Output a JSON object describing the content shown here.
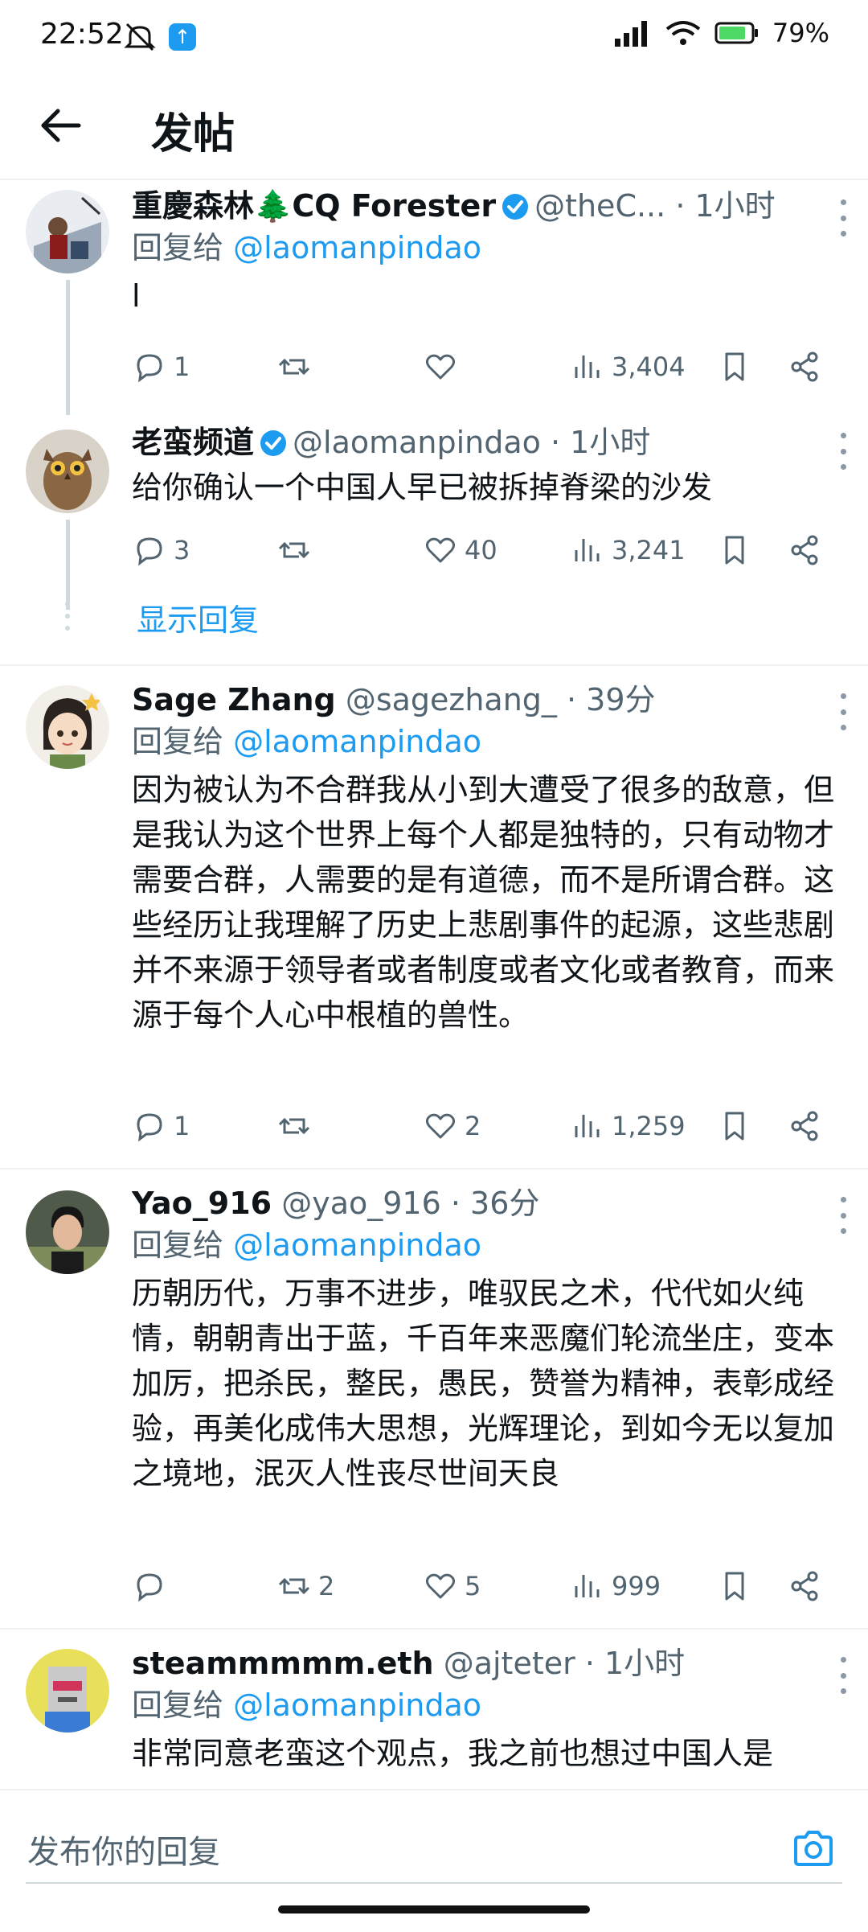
{
  "status_bar": {
    "time": "22:52",
    "battery": "79%"
  },
  "header": {
    "title": "发帖"
  },
  "tweets": [
    {
      "name": "重慶森林🌲CQ Forester",
      "handle": "@theC...",
      "time": "· 1小时",
      "reply_prefix": "回复给",
      "reply_to": "@laomanpindao",
      "text": "l",
      "replies": "1",
      "retweets": "",
      "likes": "",
      "views": "3,404"
    },
    {
      "name": "老蛮频道",
      "handle": "@laomanpindao",
      "time": "· 1小时",
      "text": "给你确认一个中国人早已被拆掉脊梁的沙发",
      "replies": "3",
      "retweets": "",
      "likes": "40",
      "views": "3,241"
    },
    {
      "name": "Sage Zhang",
      "handle": "@sagezhang_",
      "time": "· 39分",
      "reply_prefix": "回复给",
      "reply_to": "@laomanpindao",
      "text": "因为被认为不合群我从小到大遭受了很多的敌意，但是我认为这个世界上每个人都是独特的，只有动物才需要合群，人需要的是有道德，而不是所谓合群。这些经历让我理解了历史上悲剧事件的起源，这些悲剧并不来源于领导者或者制度或者文化或者教育，而来源于每个人心中根植的兽性。",
      "replies": "1",
      "retweets": "",
      "likes": "2",
      "views": "1,259"
    },
    {
      "name": "Yao_916",
      "handle": "@yao_916",
      "time": "· 36分",
      "reply_prefix": "回复给",
      "reply_to": "@laomanpindao",
      "text": "历朝历代，万事不进步，唯驭民之术，代代如火纯情，朝朝青出于蓝，千百年来恶魔们轮流坐庄，变本加厉，把杀民，整民，愚民，赞誉为精神，表彰成经验，再美化成伟大思想，光辉理论，到如今无以复加之境地，泯灭人性丧尽世间天良",
      "replies": "",
      "retweets": "2",
      "likes": "5",
      "views": "999"
    },
    {
      "name": "steammmmm.eth",
      "handle": "@ajteter",
      "time": "· 1小时",
      "reply_prefix": "回复给",
      "reply_to": "@laomanpindao",
      "text": "非常同意老蛮这个观点，我之前也想过中国人是"
    }
  ],
  "show_replies": "显示回复",
  "compose": {
    "placeholder": "发布你的回复"
  },
  "colors": {
    "accent": "#1d9bf0",
    "secondary_text": "#536471"
  }
}
